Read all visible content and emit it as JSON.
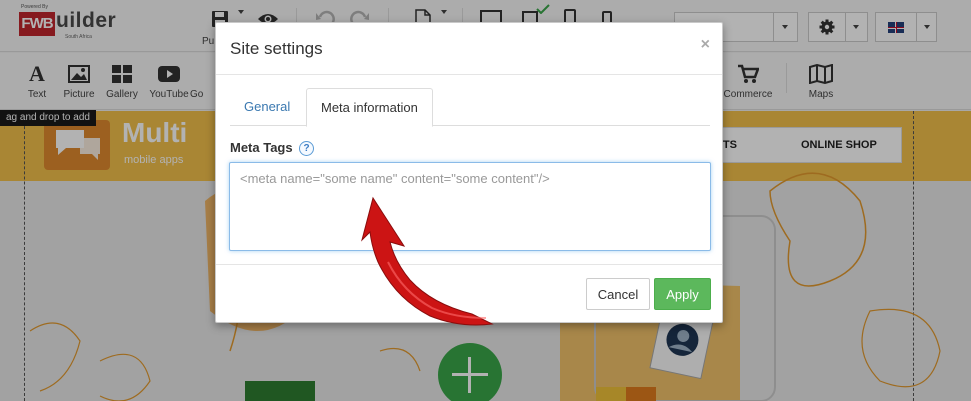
{
  "branding": {
    "powered_by": "Powered By",
    "logo_fwb": "FWB",
    "logo_rest": "uilder",
    "logo_region": "South Africa"
  },
  "topbar": {
    "publish_label": "Pu",
    "icons": [
      "save-icon",
      "preview-eye-icon",
      "undo-icon",
      "redo-icon",
      "page-icon",
      "desktop-icon",
      "tablet-icon",
      "phone-icon",
      "mobile-icon",
      "gear-icon"
    ]
  },
  "toolbar": {
    "items": [
      {
        "label": "Text",
        "icon": "text-icon"
      },
      {
        "label": "Picture",
        "icon": "picture-icon"
      },
      {
        "label": "Gallery",
        "icon": "gallery-icon"
      },
      {
        "label": "YouTube",
        "icon": "youtube-icon"
      },
      {
        "label": "Go",
        "icon": "google-icon"
      },
      {
        "label": "Commerce",
        "icon": "cart-icon"
      },
      {
        "label": "Maps",
        "icon": "map-icon"
      }
    ],
    "tooltip": "ag and drop to add"
  },
  "site_preview": {
    "brand_title": "Multi",
    "brand_subtitle": "mobile apps",
    "nav_contacts": "ACTS",
    "nav_shop": "ONLINE SHOP",
    "colors": {
      "header": "#f3c14b",
      "accent": "#e08a2e",
      "button": "#3aa74a"
    }
  },
  "modal": {
    "title": "Site settings",
    "close_symbol": "×",
    "tabs": [
      {
        "label": "General",
        "active": false
      },
      {
        "label": "Meta information",
        "active": true
      }
    ],
    "field_label": "Meta Tags",
    "help_symbol": "?",
    "textarea_placeholder": "<meta name=\"some name\" content=\"some content\"/>",
    "textarea_value": "",
    "cancel_label": "Cancel",
    "apply_label": "Apply",
    "colors": {
      "apply": "#5cb85c",
      "tab_link": "#3a78b0",
      "focus_border": "#8bbbe8"
    }
  },
  "annotation": {
    "type": "red-curved-arrow",
    "color": "#d11a1a",
    "points_to": "meta-tags-textarea"
  }
}
